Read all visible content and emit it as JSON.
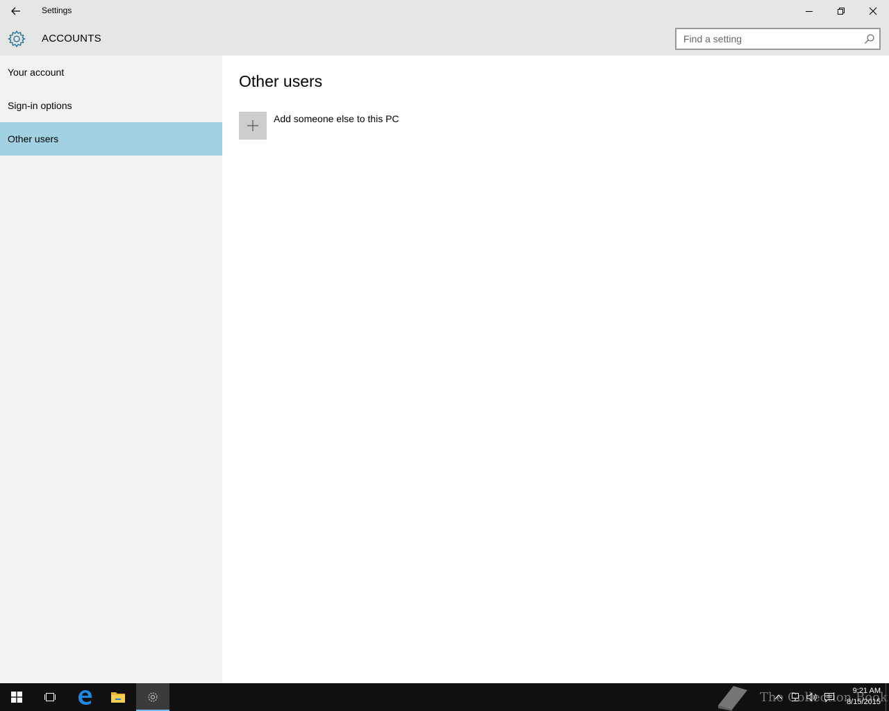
{
  "window": {
    "title": "Settings"
  },
  "header": {
    "title": "ACCOUNTS",
    "search_placeholder": "Find a setting",
    "search_value": ""
  },
  "sidebar": {
    "items": [
      {
        "label": "Your account",
        "selected": false
      },
      {
        "label": "Sign-in options",
        "selected": false
      },
      {
        "label": "Other users",
        "selected": true
      }
    ]
  },
  "main": {
    "title": "Other users",
    "add_label": "Add someone else to this PC"
  },
  "taskbar": {
    "watermark": "The Collection Book",
    "time": "9:21 AM",
    "date": "8/15/2015"
  },
  "colors": {
    "accent": "#2d7d9a",
    "selected_nav": "#a2d1e2",
    "titlebar": "#e6e6e6",
    "sidebar": "#f2f2f2",
    "taskbar": "#101010"
  },
  "icons": {
    "back": "back-arrow-icon",
    "minimize": "minimize-icon",
    "restore": "restore-icon",
    "close": "close-icon",
    "gear": "gear-icon",
    "search": "search-icon",
    "plus": "plus-icon",
    "start": "windows-logo-icon",
    "task_view": "task-view-icon",
    "edge": "edge-icon",
    "explorer": "folder-icon",
    "settings_app": "settings-app-icon",
    "tray_up": "chevron-up-icon",
    "network": "network-icon",
    "volume": "volume-icon",
    "action_center": "action-center-icon"
  }
}
